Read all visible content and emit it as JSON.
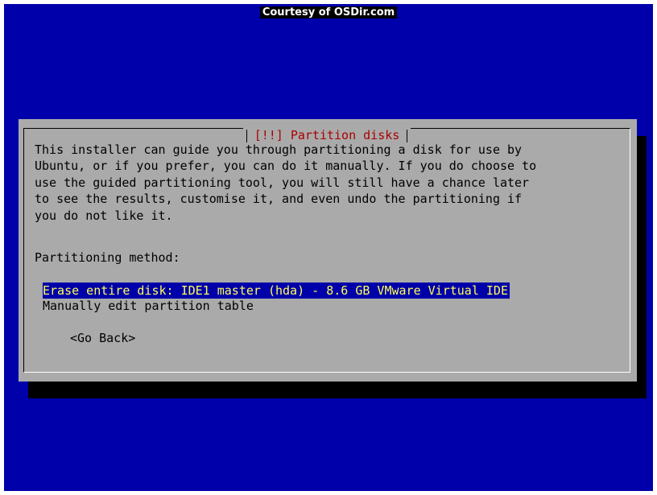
{
  "watermark": "Courtesy of OSDir.com",
  "dialog": {
    "title": "[!!] Partition disks",
    "body": "This installer can guide you through partitioning a disk for use by\nUbuntu, or if you prefer, you can do it manually. If you do choose to\nuse the guided partitioning tool, you will still have a chance later\nto see the results, customise it, and even undo the partitioning if\nyou do not like it.",
    "method_label": "Partitioning method:",
    "options": [
      {
        "label": "Erase entire disk: IDE1 master (hda) - 8.6 GB VMware Virtual IDE",
        "selected": true
      },
      {
        "label": "Manually edit partition table",
        "selected": false
      }
    ],
    "go_back": "<Go Back>"
  },
  "colors": {
    "background": "#0000aa",
    "dialog": "#aaaaaa",
    "title_text": "#aa0000",
    "selected_bg": "#0000aa",
    "selected_text": "#ffff55"
  }
}
